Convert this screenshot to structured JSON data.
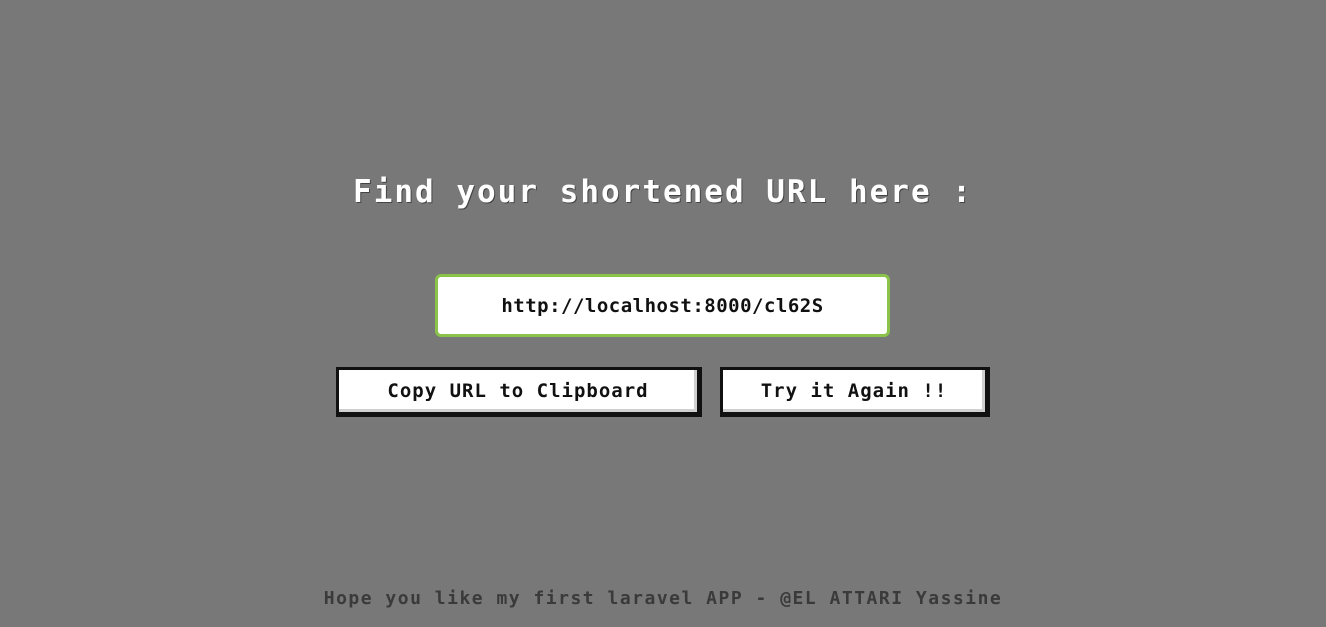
{
  "page": {
    "title": "Find your shortened URL here :",
    "background_color": "#787878"
  },
  "result": {
    "short_url": "http://localhost:8000/cl62S",
    "border_color": "#8bc34a"
  },
  "actions": {
    "copy_label": "Copy URL to Clipboard",
    "again_label": "Try it Again !!"
  },
  "footer": {
    "text": "Hope you like my first laravel APP - @EL ATTARI Yassine"
  }
}
